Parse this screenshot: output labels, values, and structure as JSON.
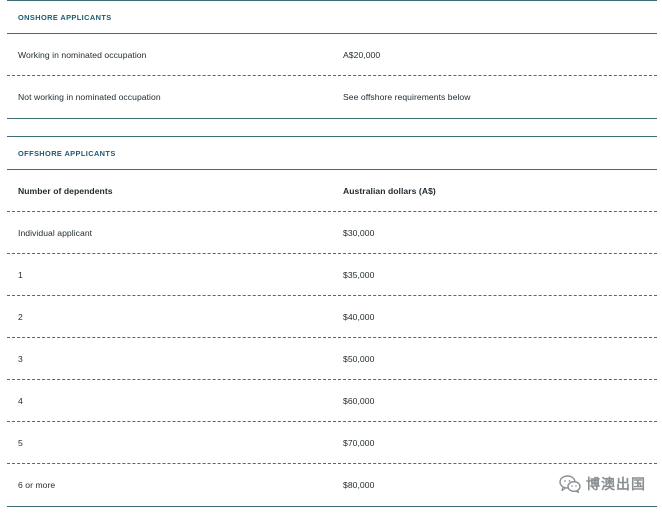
{
  "onshore": {
    "title": "ONSHORE APPLICANTS",
    "rows": [
      {
        "label": "Working in nominated occupation",
        "value": "A$20,000"
      },
      {
        "label": "Not working in nominated occupation",
        "value": "See offshore requirements below"
      }
    ]
  },
  "offshore": {
    "title": "OFFSHORE APPLICANTS",
    "headers": {
      "col1": "Number of dependents",
      "col2": "Australian dollars (A$)"
    },
    "rows": [
      {
        "label": "Individual applicant",
        "value": "$30,000"
      },
      {
        "label": "1",
        "value": "$35,000"
      },
      {
        "label": "2",
        "value": "$40,000"
      },
      {
        "label": "3",
        "value": "$50,000"
      },
      {
        "label": "4",
        "value": "$60,000"
      },
      {
        "label": "5",
        "value": "$70,000"
      },
      {
        "label": "6 or more",
        "value": "$80,000"
      }
    ]
  },
  "watermark": {
    "text": "博澳出国",
    "icon": "wechat-chat-icon",
    "color": "#8a8f92"
  },
  "colors": {
    "border": "#3f6b73",
    "heading": "#1a5b73",
    "text": "#1f2a30"
  }
}
